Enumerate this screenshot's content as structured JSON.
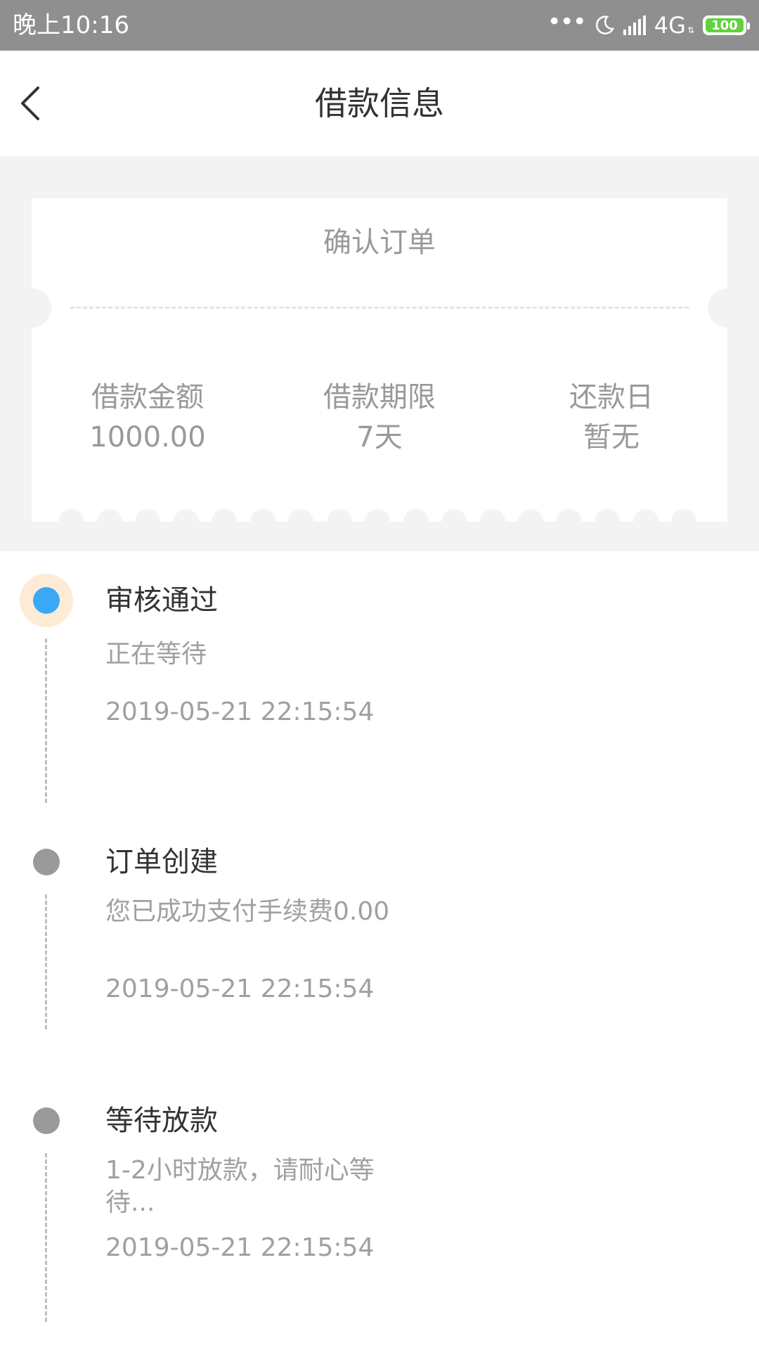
{
  "status_bar": {
    "time": "晚上10:16",
    "network": "4G",
    "battery": "100",
    "icons": [
      "more-dots-icon",
      "moon-icon",
      "signal-icon",
      "battery-icon"
    ]
  },
  "nav": {
    "title": "借款信息",
    "back_icon": "chevron-left-icon"
  },
  "ticket": {
    "title": "确认订单",
    "columns": [
      {
        "label": "借款金额",
        "value": "1000.00"
      },
      {
        "label": "借款期限",
        "value": "7天"
      },
      {
        "label": "还款日",
        "value": "暂无"
      }
    ]
  },
  "timeline": [
    {
      "title": "审核通过",
      "desc": "正在等待",
      "time": "2019-05-21 22:15:54",
      "status": "active"
    },
    {
      "title": "订单创建",
      "desc": "您已成功支付手续费0.00",
      "time": "2019-05-21 22:15:54",
      "status": "done"
    },
    {
      "title": "等待放款",
      "desc": "1-2小时放款，请耐心等待...",
      "time": "2019-05-21 22:15:54",
      "status": "done"
    }
  ],
  "colors": {
    "status_bar_bg": "#8f8f8f",
    "page_bg": "#f3f3f3",
    "active_dot": "#3aa9f5",
    "active_halo": "#fdebd6",
    "inactive_dot": "#9a9a9a",
    "battery_green": "#5fd33b"
  }
}
